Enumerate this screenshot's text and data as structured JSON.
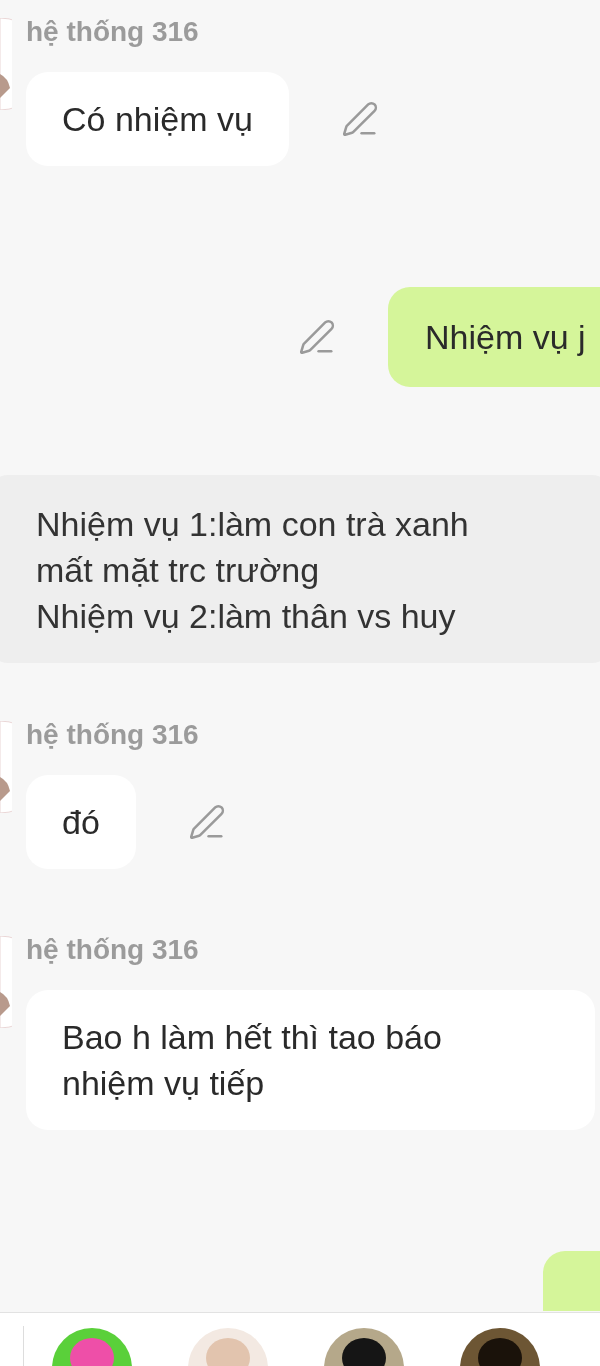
{
  "messages": [
    {
      "kind": "incoming",
      "sender": "hệ thống 316",
      "text": "Có nhiệm vụ",
      "editable": true
    },
    {
      "kind": "outgoing",
      "text": "Nhiệm vụ j",
      "editable": true
    },
    {
      "kind": "narration",
      "paragraphs": [
        "Nhiệm vụ 1:làm con trà xanh mất mặt trc trường",
        "Nhiệm vụ 2:làm thân vs huy"
      ]
    },
    {
      "kind": "incoming",
      "sender": "hệ thống 316",
      "text": "đó",
      "editable": true
    },
    {
      "kind": "incoming",
      "sender": "hệ thống 316",
      "text": "Bao h làm hết thì tao báo nhiệm vụ tiếp",
      "editable": false
    },
    {
      "kind": "outgoing_cut"
    }
  ]
}
